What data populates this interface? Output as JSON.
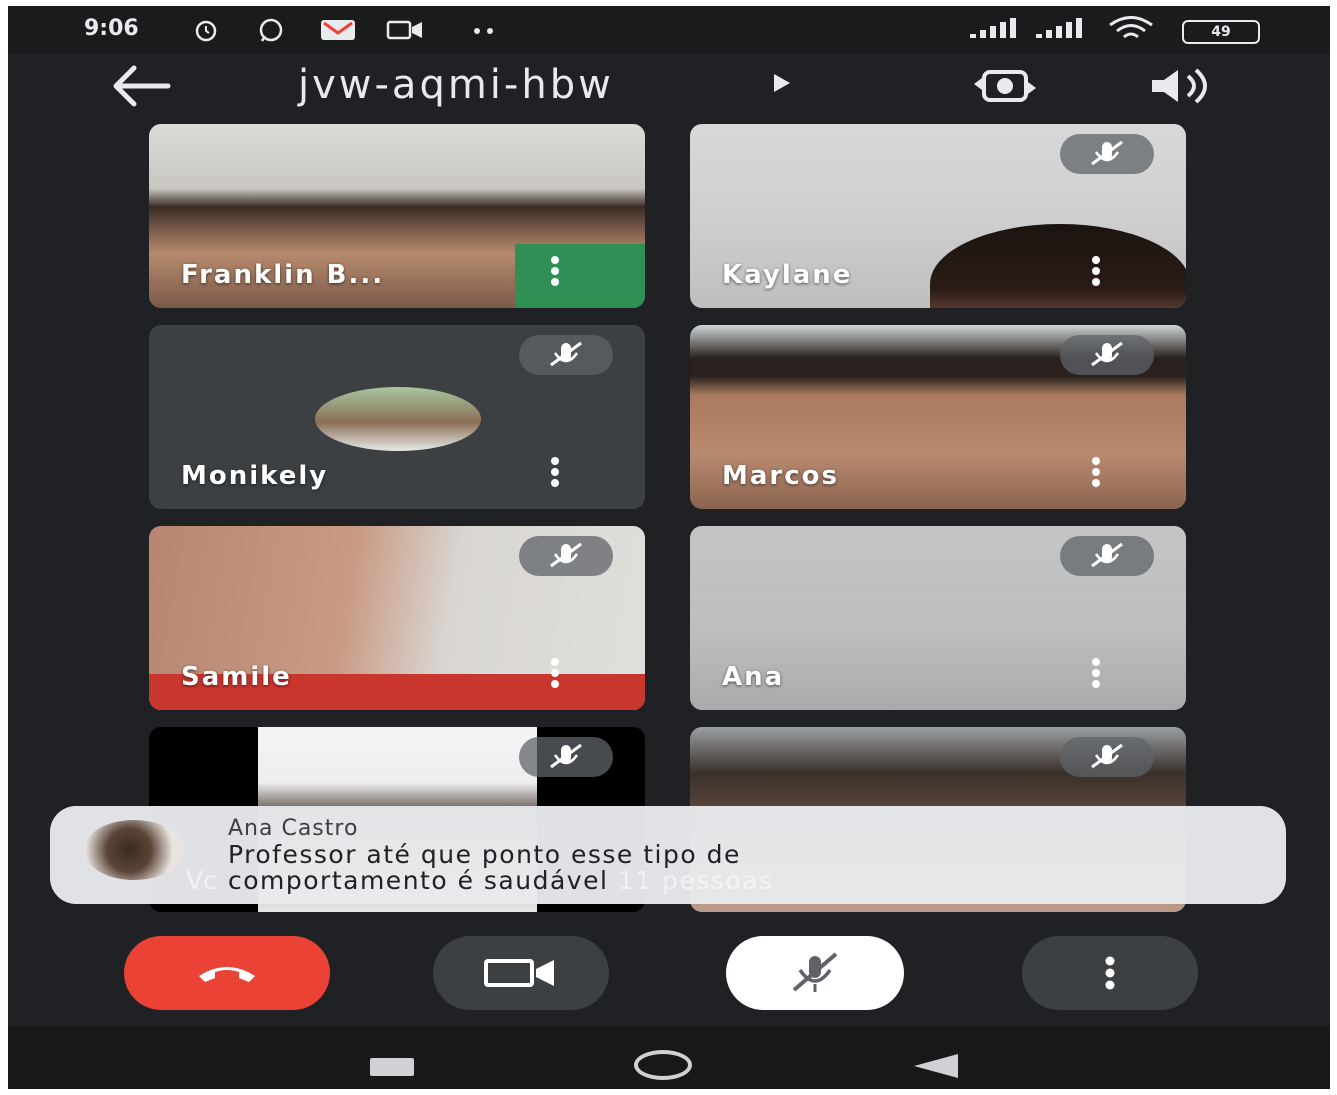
{
  "status_bar": {
    "time": "9:06",
    "battery": "49"
  },
  "top_bar": {
    "meeting_code": "jvw-aqmi-hbw"
  },
  "participants": [
    {
      "name": "Franklin B...",
      "muted": false
    },
    {
      "name": "Kaylane",
      "muted": true
    },
    {
      "name": "Monikely",
      "muted": true
    },
    {
      "name": "Marcos",
      "muted": true
    },
    {
      "name": "Samile",
      "muted": true
    },
    {
      "name": "Ana",
      "muted": true
    },
    {
      "name": "",
      "muted": true
    },
    {
      "name": "",
      "muted": true
    }
  ],
  "toast": {
    "sender": "Ana Castro",
    "message_line1": "Professor até que ponto esse tipo de",
    "message_line2": "comportamento é saudável",
    "underlying_count": "11 pessoas",
    "underlying_partial": "Vc"
  },
  "colors": {
    "end_call": "#ea4335",
    "background": "#202124",
    "tile": "#3c4043"
  },
  "icons": {
    "back": "arrow-left-icon",
    "switch_camera": "switch-camera-icon",
    "speaker": "speaker-icon",
    "mic_off": "mic-off-icon",
    "camera": "video-camera-icon",
    "end_call": "phone-hangup-icon",
    "more": "more-vert-icon"
  }
}
